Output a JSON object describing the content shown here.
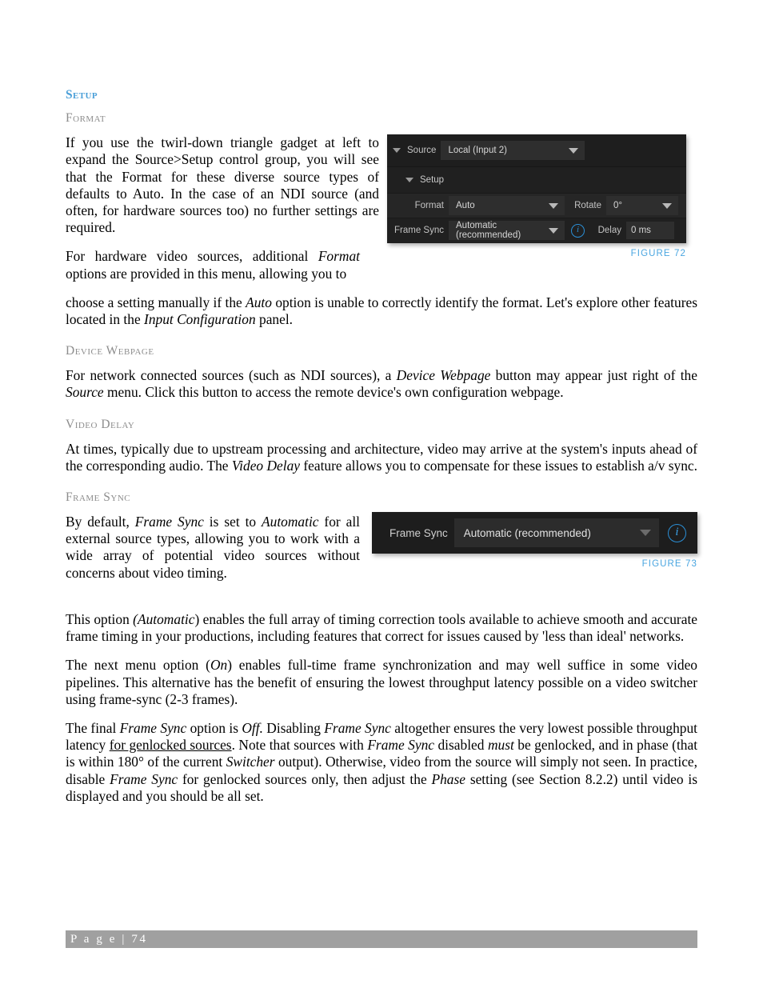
{
  "page": {
    "footer_label": "P a g e  | 74"
  },
  "headings": {
    "setup": "Setup",
    "format": "Format",
    "device_webpage": "Device Webpage",
    "video_delay": "Video Delay",
    "frame_sync": "Frame Sync"
  },
  "paragraphs": {
    "format_p1_a": "If you use the twirl-down triangle gadget at left to expand the Source>Setup control group, you will see that the Format for these diverse source types of defaults to Auto.  In the case of an NDI source (and often, for hardware sources too) no further settings are required.",
    "format_p2_narrow": "For hardware video sources, additional ",
    "format_p2_italic": "Format",
    "format_p2_narrow_b": " options are provided in this menu, allowing you to ",
    "format_p2_rest_a": "choose a setting manually if the ",
    "format_p2_italic2": "Auto",
    "format_p2_rest_b": " option is unable to correctly identify the format. Let's explore other features located in the ",
    "format_p2_italic3": "Input Configuration",
    "format_p2_rest_c": " panel.",
    "device_webpage_a": "For network connected sources (such as NDI sources), a ",
    "device_webpage_i1": "Device Webpage",
    "device_webpage_b": " button may appear just right of the ",
    "device_webpage_i2": "Source",
    "device_webpage_c": " menu.  Click this button to access the remote device's own configuration webpage.",
    "video_delay_a": "At times, typically due to upstream processing and architecture, video may arrive at the system's inputs ahead of the corresponding audio.  The ",
    "video_delay_i1": "Video Delay",
    "video_delay_b": " feature allows you to compensate for these issues to establish a/v sync.",
    "frame_sync_a": "By default, ",
    "frame_sync_i1": "Frame Sync",
    "frame_sync_b": " is set to ",
    "frame_sync_i2": "Automatic",
    "frame_sync_c": " for all external source types, allowing you to work with a wide array of potential video sources without concerns about video timing.",
    "auto_a": "This option ",
    "auto_i1": "(Automatic",
    "auto_b": ") enables the full array of timing correction tools available to achieve smooth and accurate frame timing in your productions, including features that correct for issues caused by 'less than ideal' networks.",
    "on_a": "The next menu option (",
    "on_i1": "On",
    "on_b": ") enables full-time frame synchronization and may well suffice in some video pipelines.  This alternative has the benefit of ensuring the lowest throughput latency possible on a video switcher using frame-sync (2-3 frames).",
    "off_a": "The final ",
    "off_i1": "Frame Sync",
    "off_b": " option is ",
    "off_i2": "Off.",
    "off_c": "  Disabling ",
    "off_i3": "Frame Sync",
    "off_d": " altogether ensures the very lowest possible throughput latency ",
    "off_u1": "for genlocked sources",
    "off_e": ".  Note that sources with ",
    "off_i4": "Frame Sync",
    "off_f": " disabled ",
    "off_i5": "must",
    "off_g": " be genlocked, and in phase (that is within 180° of the current ",
    "off_i6": "Switcher",
    "off_h": " output).  Otherwise, video from the source will simply not seen.  In practice, disable ",
    "off_i7": "Frame Sync",
    "off_i": " for genlocked sources only, then adjust the ",
    "off_i8": "Phase",
    "off_j": " setting (see Section 8.2.2) until video is displayed and you should be all set."
  },
  "figure72": {
    "caption": "FIGURE 72",
    "source_label": "Source",
    "source_value": "Local (Input 2)",
    "setup_label": "Setup",
    "format_label": "Format",
    "format_value": "Auto",
    "rotate_label": "Rotate",
    "rotate_value": "0°",
    "frame_sync_label": "Frame Sync",
    "frame_sync_value": "Automatic (recommended)",
    "delay_label": "Delay",
    "delay_value": "0 ms",
    "info_glyph": "i"
  },
  "figure73": {
    "caption": "FIGURE 73",
    "frame_sync_label": "Frame Sync",
    "frame_sync_value": "Automatic (recommended)",
    "info_glyph": "i"
  },
  "colors": {
    "accent_blue": "#4a9fd8",
    "caption_blue": "#49a5e0",
    "heading_gray": "#8d8d8d",
    "footer_gray": "#a0a0a0",
    "panel_dark": "#1d1d1d"
  }
}
